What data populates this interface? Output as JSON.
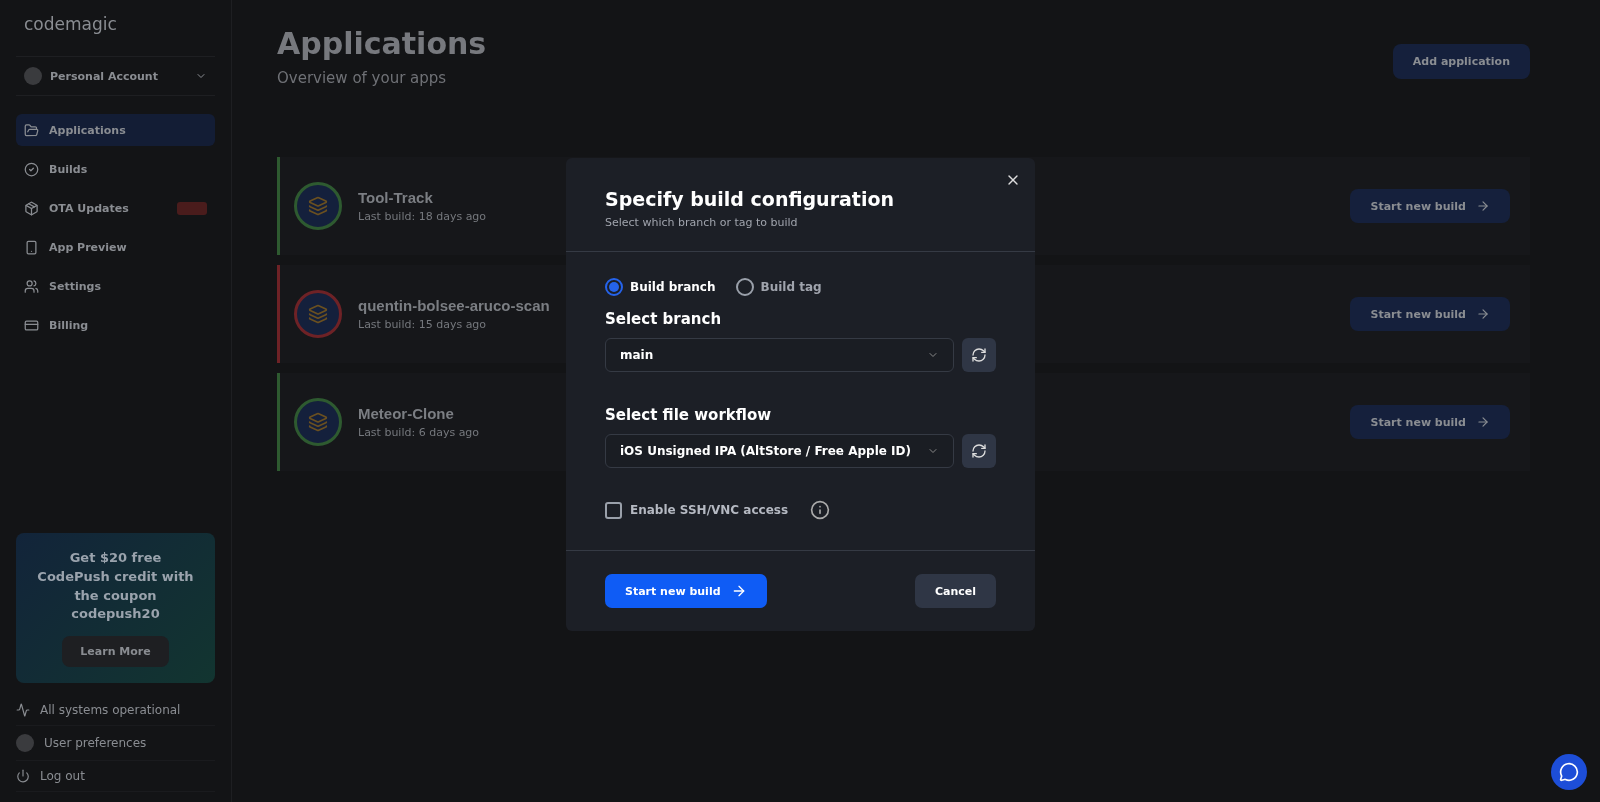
{
  "sidebar": {
    "logo": "codemagic",
    "account": "Personal Account",
    "nav": [
      {
        "label": "Applications",
        "selected": true,
        "badge": false
      },
      {
        "label": "Builds",
        "selected": false,
        "badge": false
      },
      {
        "label": "OTA Updates",
        "selected": false,
        "badge": true
      },
      {
        "label": "App Preview",
        "selected": false,
        "badge": false
      },
      {
        "label": "Settings",
        "selected": false,
        "badge": false
      },
      {
        "label": "Billing",
        "selected": false,
        "badge": false
      }
    ],
    "promo": {
      "text": "Get $20 free CodePush credit with the coupon codepush20",
      "button": "Learn More"
    },
    "status": "All systems operational",
    "preferences": "User preferences",
    "logout": "Log out"
  },
  "main": {
    "title": "Applications",
    "subtitle": "Overview of your apps",
    "add_button": "Add application",
    "apps": [
      {
        "name": "Tool-Track",
        "last_build_label": "Last build:",
        "last_build": "18 days ago",
        "color": "#2e5a30",
        "action": "Start new build"
      },
      {
        "name": "quentin-bolsee-aruco-scan",
        "last_build_label": "Last build:",
        "last_build": "15 days ago",
        "color": "#6e2226",
        "action": "Start new build"
      },
      {
        "name": "Meteor-Clone",
        "last_build_label": "Last build:",
        "last_build": "6 days ago",
        "color": "#2e5a30",
        "action": "Start new build"
      }
    ]
  },
  "modal": {
    "title": "Specify build configuration",
    "subtitle": "Select which branch or tag to build",
    "options": [
      {
        "label": "Build branch",
        "selected": true
      },
      {
        "label": "Build tag",
        "selected": false
      }
    ],
    "branch_label": "Select branch",
    "branch_value": "main",
    "workflow_label": "Select file workflow",
    "workflow_value": "iOS Unsigned IPA (AltStore / Free Apple ID)",
    "ssh": {
      "label": "Enable SSH/VNC access",
      "checked": false
    },
    "primary": "Start new build",
    "cancel": "Cancel"
  }
}
